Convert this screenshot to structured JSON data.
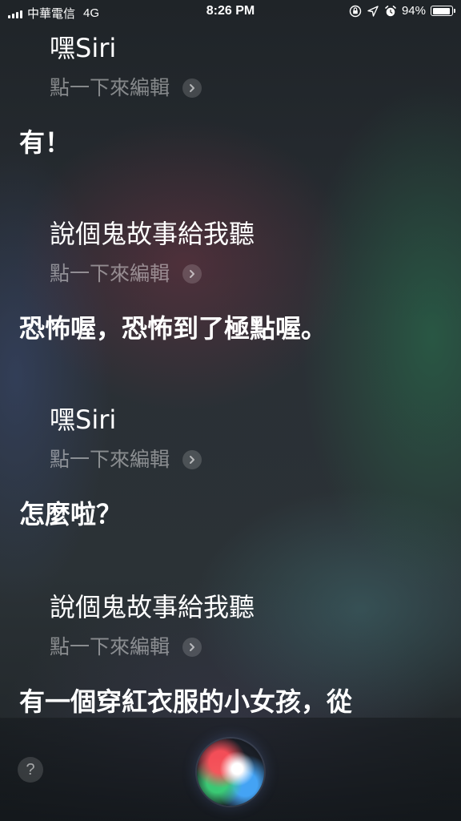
{
  "status_bar": {
    "carrier": "中華電信",
    "network": "4G",
    "time": "8:26 PM",
    "battery": "94%",
    "battery_level": 0.94,
    "icons": [
      "signal-icon",
      "rotation-lock-icon",
      "location-arrow-icon",
      "alarm-icon",
      "battery-icon"
    ]
  },
  "conversation": {
    "q1": "嘿Siri",
    "e1": "點一下來編輯",
    "r1": "有！",
    "q2": "說個鬼故事給我聽",
    "e2": "點一下來編輯",
    "r2": "恐怖喔，恐怖到了極點喔。",
    "q3": "嘿Siri",
    "e3": "點一下來編輯",
    "r3": "怎麼啦？",
    "q4": "說個鬼故事給我聽",
    "e4": "點一下來編輯",
    "r4": "有一個穿紅衣服的小女孩，從"
  },
  "bottom": {
    "help": "?",
    "orb_icon": "siri-orb-icon"
  }
}
